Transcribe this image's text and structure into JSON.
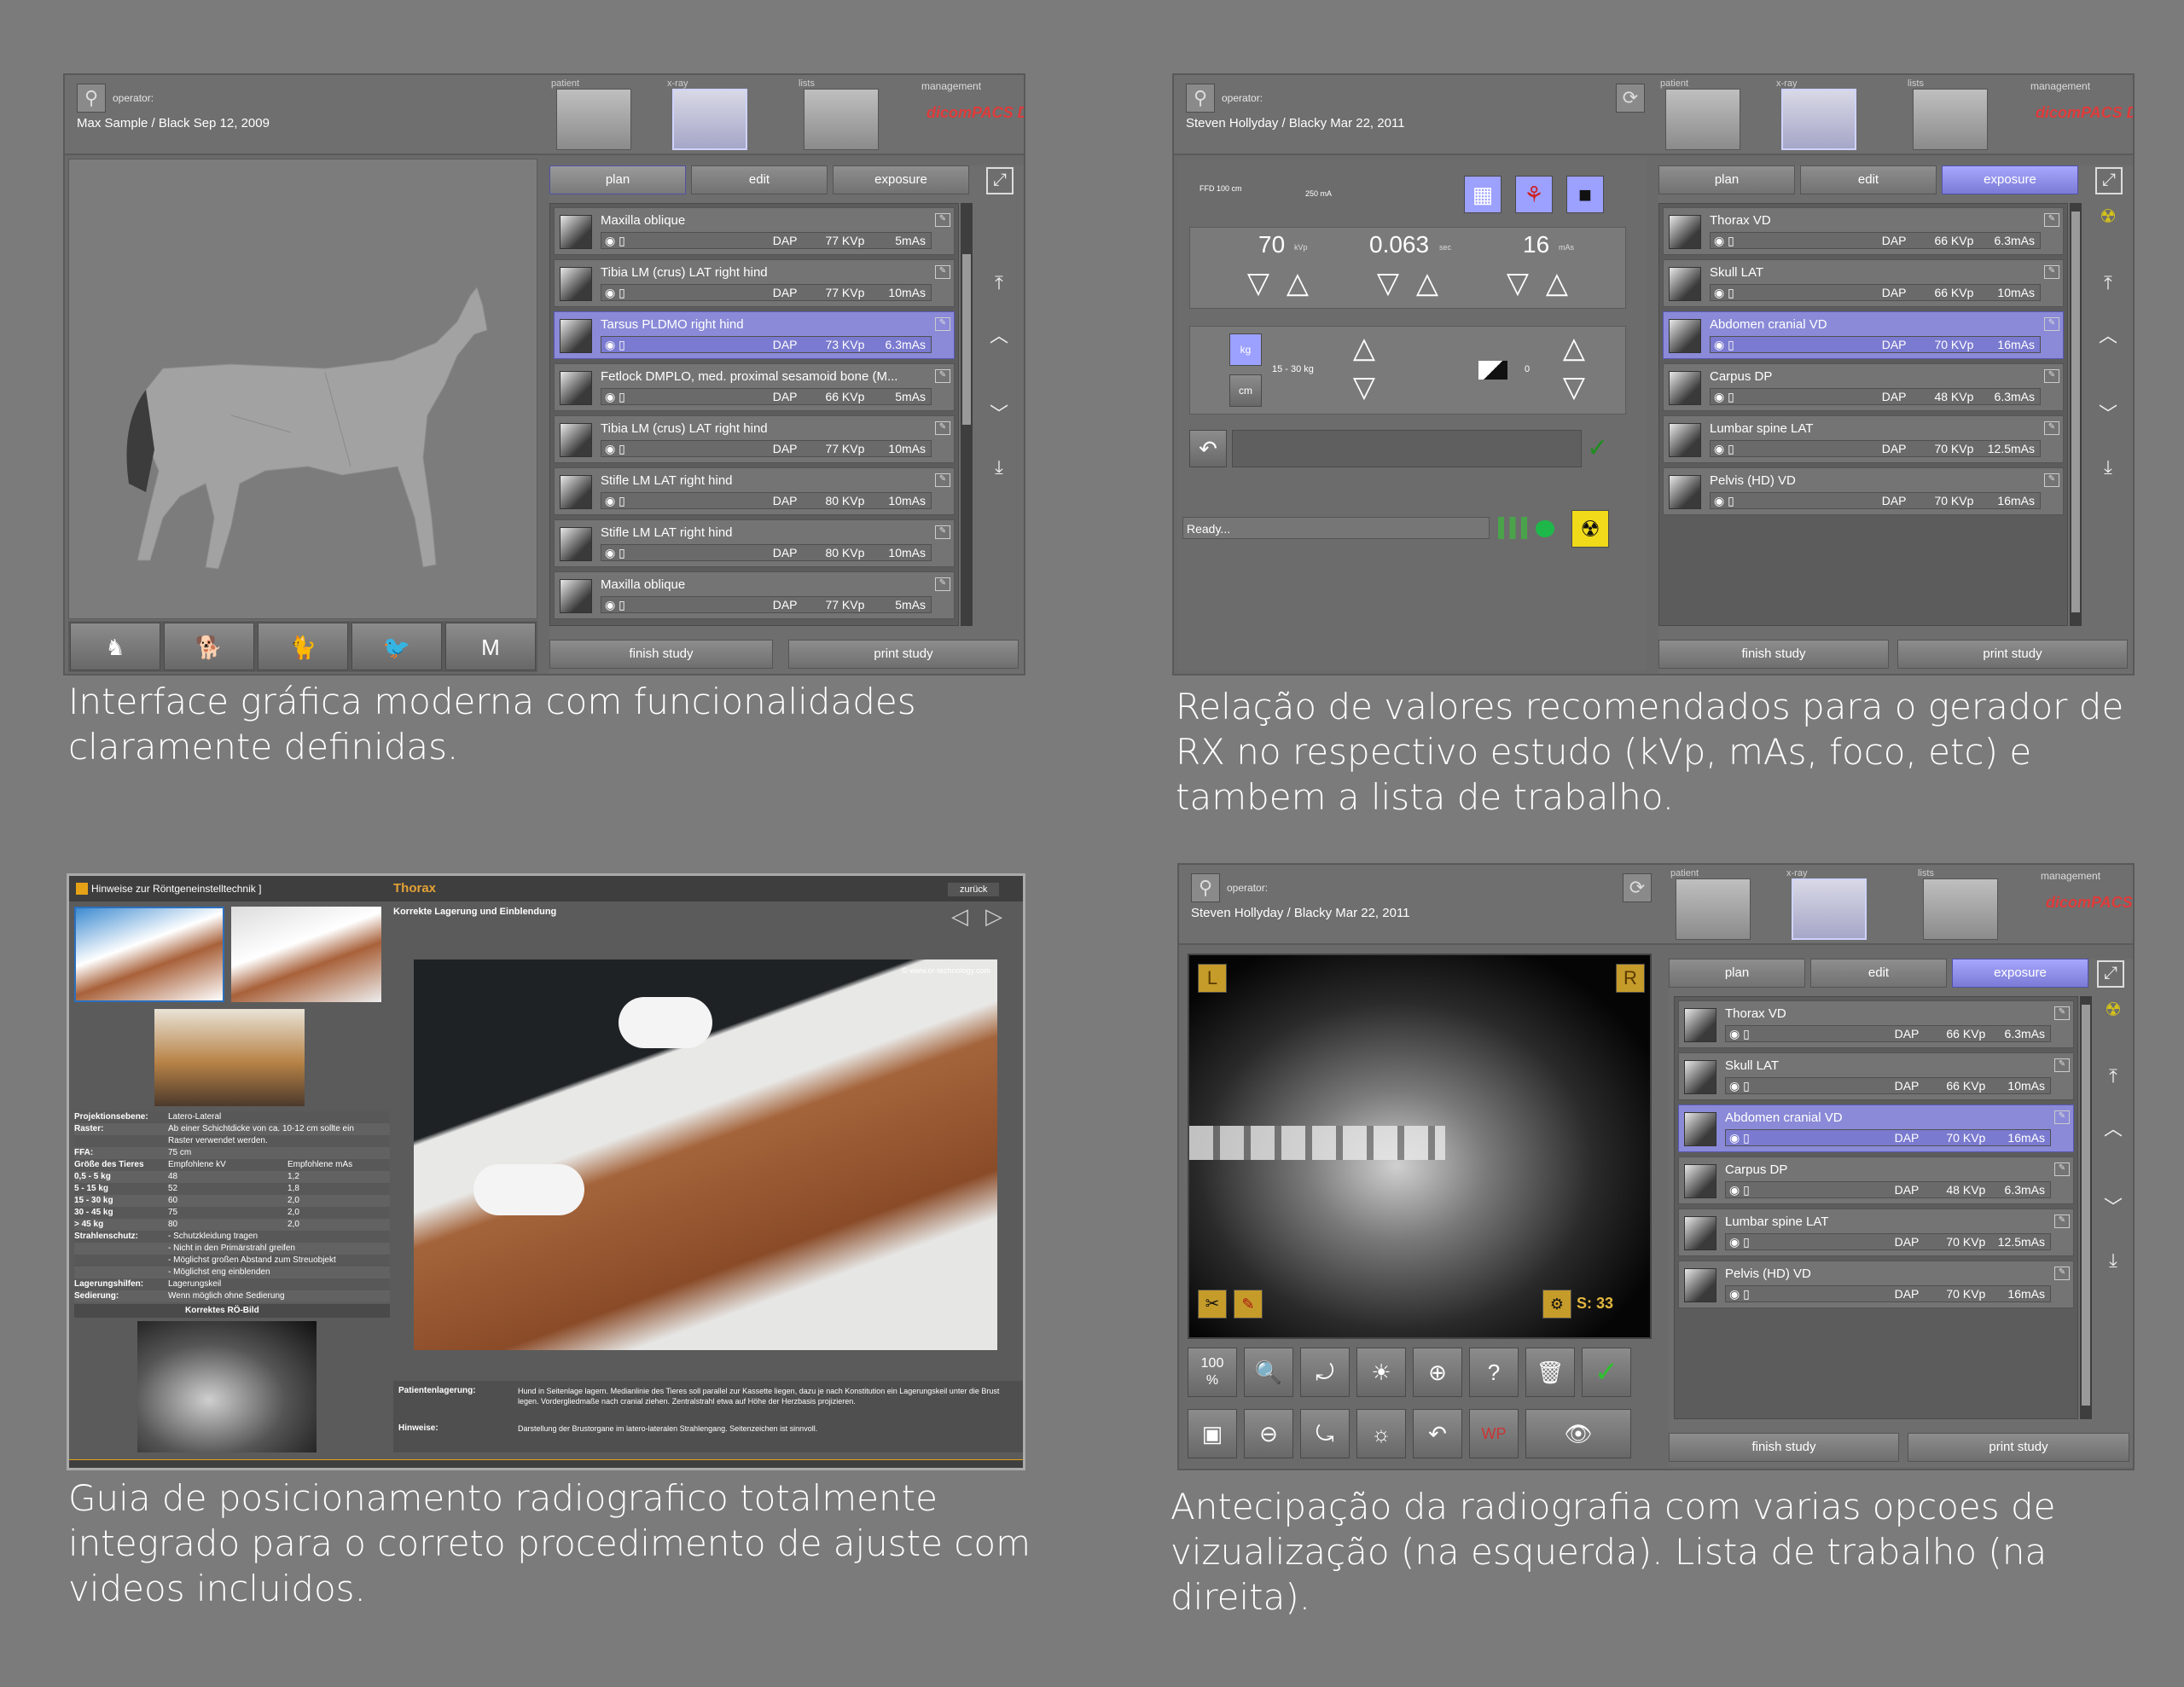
{
  "panel1": {
    "operator_label": "operator:",
    "operator_name": "Max Sample / Black  Sep 12, 2009",
    "top_tabs": [
      "patient",
      "x-ray",
      "lists",
      "management"
    ],
    "logo": "dicomPACS DX-R",
    "tabs": [
      "plan",
      "edit",
      "exposure"
    ],
    "items": [
      {
        "name": "Maxilla oblique",
        "dap": "DAP",
        "kvp": "77 KVp",
        "mas": "5mAs"
      },
      {
        "name": "Tibia LM (crus) LAT right hind",
        "dap": "DAP",
        "kvp": "77 KVp",
        "mas": "10mAs"
      },
      {
        "name": "Tarsus PLDMO right hind",
        "dap": "DAP",
        "kvp": "73 KVp",
        "mas": "6.3mAs"
      },
      {
        "name": "Fetlock DMPLO, med. proximal sesamoid bone (M...",
        "dap": "DAP",
        "kvp": "66 KVp",
        "mas": "5mAs"
      },
      {
        "name": "Tibia LM (crus) LAT right hind",
        "dap": "DAP",
        "kvp": "77 KVp",
        "mas": "10mAs"
      },
      {
        "name": "Stifle LM LAT right hind",
        "dap": "DAP",
        "kvp": "80 KVp",
        "mas": "10mAs"
      },
      {
        "name": "Stifle LM LAT right hind",
        "dap": "DAP",
        "kvp": "80 KVp",
        "mas": "10mAs"
      },
      {
        "name": "Maxilla oblique",
        "dap": "DAP",
        "kvp": "77 KVp",
        "mas": "5mAs"
      }
    ],
    "finish": "finish study",
    "print": "print study",
    "caption": "Interface gráfica moderna com funcionalidades claramente definidas."
  },
  "panel2": {
    "operator_label": "operator:",
    "operator_name": "Steven Hollyday / Blacky  Mar 22, 2011",
    "top_tabs": [
      "patient",
      "x-ray",
      "lists",
      "management"
    ],
    "logo": "dicomPACS DX-R",
    "ffd": "FFD 100 cm",
    "ma": "250 mA",
    "kv_value": "70",
    "kv_unit": "kVp",
    "sec_value": "0.063",
    "sec_unit": "sec",
    "mas_value": "16",
    "mas_unit": "mAs",
    "kg": "kg",
    "cm": "cm",
    "weight_range": "15 - 30 kg",
    "zero": "0",
    "status": "Ready...",
    "tabs": [
      "plan",
      "edit",
      "exposure"
    ],
    "items": [
      {
        "name": "Thorax VD",
        "dap": "DAP",
        "kvp": "66 KVp",
        "mas": "6.3mAs"
      },
      {
        "name": "Skull LAT",
        "dap": "DAP",
        "kvp": "66 KVp",
        "mas": "10mAs"
      },
      {
        "name": "Abdomen cranial VD",
        "dap": "DAP",
        "kvp": "70 KVp",
        "mas": "16mAs"
      },
      {
        "name": "Carpus DP",
        "dap": "DAP",
        "kvp": "48 KVp",
        "mas": "6.3mAs"
      },
      {
        "name": "Lumbar spine LAT",
        "dap": "DAP",
        "kvp": "70 KVp",
        "mas": "12.5mAs"
      },
      {
        "name": "Pelvis (HD) VD",
        "dap": "DAP",
        "kvp": "70 KVp",
        "mas": "16mAs"
      }
    ],
    "finish": "finish study",
    "print": "print study",
    "caption": "Relação de valores recomendados para o gerador de RX no respectivo estudo (kVp, mAs, foco, etc) e tambem a lista de trabalho."
  },
  "panel3": {
    "window_title": "Hinweise zur Röntgeneinstelltechnik ]",
    "section": "Thorax",
    "back": "zurück",
    "subtitle": "Korrekte Lagerung und Einblendung",
    "watermark": "© www.or-technology.com",
    "info_rows": [
      [
        "Projektionsebene:",
        "Latero-Lateral",
        ""
      ],
      [
        "Raster:",
        "Ab einer Schichtdicke von ca. 10-12 cm sollte ein",
        ""
      ],
      [
        "",
        "Raster verwendet werden.",
        ""
      ],
      [
        "FFA:",
        "75 cm",
        ""
      ],
      [
        "Größe des Tieres",
        "Empfohlene kV",
        "Empfohlene mAs"
      ],
      [
        "0,5 - 5 kg",
        "48",
        "1,2"
      ],
      [
        "5 - 15 kg",
        "52",
        "1,8"
      ],
      [
        "15 - 30 kg",
        "60",
        "2,0"
      ],
      [
        "30 - 45 kg",
        "75",
        "2,0"
      ],
      [
        "> 45 kg",
        "80",
        "2,0"
      ],
      [
        "Strahlenschutz:",
        "- Schutzkleidung tragen",
        ""
      ],
      [
        "",
        "- Nicht in den Primärstrahl greifen",
        ""
      ],
      [
        "",
        "- Möglichst großen Abstand zum Streuobjekt",
        ""
      ],
      [
        "",
        "- Möglichst eng einblenden",
        ""
      ],
      [
        "Lagerungshilfen:",
        "Lagerungskeil",
        ""
      ],
      [
        "Sedierung:",
        "Wenn möglich ohne Sedierung",
        ""
      ]
    ],
    "correct_image": "Korrektes RÖ-Bild",
    "positioning_label": "Patientenlagerung:",
    "positioning_text": "Hund in Seitenlage lagern. Medianlinie des Tieres soll parallel zur Kassette liegen, dazu je nach Konstitution ein Lagerungskeil unter die Brust legen. Vordergliedmaße nach cranial ziehen. Zentralstrahl etwa auf Höhe der Herzbasis projizieren.",
    "hint_label": "Hinweise:",
    "hint_text": "Darstellung der Brustorgane im latero-lateralen Strahlengang. Seitenzeichen ist sinnvoll.",
    "caption": "Guia  de  posicionamento radiografico totalmente integrado para o correto procedimento de ajuste com videos incluidos."
  },
  "panel4": {
    "operator_label": "operator:",
    "operator_name": "Steven Hollyday / Blacky  Mar 22, 2011",
    "top_tabs": [
      "patient",
      "x-ray",
      "lists",
      "management"
    ],
    "logo": "dicomPACS DX-R",
    "marker_l": "L",
    "marker_r": "R",
    "s_value": "S: 33",
    "zoom": "100\n%",
    "tabs": [
      "plan",
      "edit",
      "exposure"
    ],
    "items": [
      {
        "name": "Thorax VD",
        "dap": "DAP",
        "kvp": "66 KVp",
        "mas": "6.3mAs"
      },
      {
        "name": "Skull LAT",
        "dap": "DAP",
        "kvp": "66 KVp",
        "mas": "10mAs"
      },
      {
        "name": "Abdomen cranial VD",
        "dap": "DAP",
        "kvp": "70 KVp",
        "mas": "16mAs"
      },
      {
        "name": "Carpus DP",
        "dap": "DAP",
        "kvp": "48 KVp",
        "mas": "6.3mAs"
      },
      {
        "name": "Lumbar spine LAT",
        "dap": "DAP",
        "kvp": "70 KVp",
        "mas": "12.5mAs"
      },
      {
        "name": "Pelvis (HD) VD",
        "dap": "DAP",
        "kvp": "70 KVp",
        "mas": "16mAs"
      }
    ],
    "finish": "finish study",
    "print": "print study",
    "caption": "Antecipação da radiografia com varias opcoes de vizualização (na esquerda).   Lista de trabalho (na direita)."
  }
}
